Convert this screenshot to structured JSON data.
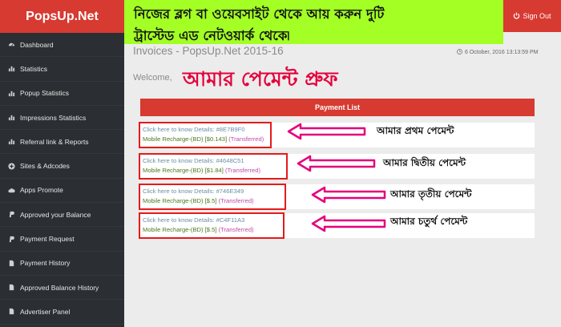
{
  "app": {
    "brand": "PopsUp.Net"
  },
  "sidebar": {
    "items": [
      {
        "label": "Dashboard",
        "icon": "dashboard-icon"
      },
      {
        "label": "Statistics",
        "icon": "bar-chart-icon"
      },
      {
        "label": "Popup Statistics",
        "icon": "bar-chart-icon"
      },
      {
        "label": "Impressions Statistics",
        "icon": "bar-chart-icon"
      },
      {
        "label": "Referral link & Reports",
        "icon": "bar-chart-icon"
      },
      {
        "label": "Sites & Adcodes",
        "icon": "plus-circle-icon"
      },
      {
        "label": "Apps Promote",
        "icon": "cloud-icon"
      },
      {
        "label": "Approved your Balance",
        "icon": "paypal-icon"
      },
      {
        "label": "Payment Request",
        "icon": "paypal-icon"
      },
      {
        "label": "Payment History",
        "icon": "document-icon"
      },
      {
        "label": "Approved Balance History",
        "icon": "document-icon"
      },
      {
        "label": "Advertiser Panel",
        "icon": "document-icon"
      }
    ]
  },
  "banner": {
    "line1": "নিজের ব্লগ বা ওয়েবসাইট থেকে আয় করুন দুটি",
    "line2": "ট্রাস্টেড এড নেটওয়ার্ক থেকে৷"
  },
  "header": {
    "signout_label": "Sign Out",
    "page_title": "Invoices - PopsUp.Net 2015-16",
    "datetime": "6 October, 2016 13:13:59 PM",
    "welcome": "Welcome,",
    "overlay_title": "আমার পেমেন্ট প্রুফ"
  },
  "payments": {
    "header": "Payment List",
    "rows": [
      {
        "link": "Click here to know Details: #8E7B9F0",
        "detail": "Mobile Recharge-(BD) [$0.143]",
        "status": "(Transferred)",
        "annotation": "আমার প্রথম পেমেন্ট"
      },
      {
        "link": "Click here to know Details: #4648C51",
        "detail": "Mobile Recharge-(BD) [$1.84]",
        "status": "(Transferred)",
        "annotation": "আমার দ্বিতীয় পেমেন্ট"
      },
      {
        "link": "Click here to know Details: #746E349",
        "detail": "Mobile Recharge-(BD) [$.5]",
        "status": "(Transferred)",
        "annotation": "আমার তৃতীয় পেমেন্ট"
      },
      {
        "link": "Click here to know Details: #C4F11A3",
        "detail": "Mobile Recharge-(BD) [$.5]",
        "status": "(Transferred)",
        "annotation": "আমার চতুর্থ পেমেন্ট"
      }
    ]
  },
  "colors": {
    "brand_red": "#d73a31",
    "sidebar_bg": "#2b2f33",
    "banner_green": "#a3ff24",
    "annotation_pink": "#e4007c"
  }
}
